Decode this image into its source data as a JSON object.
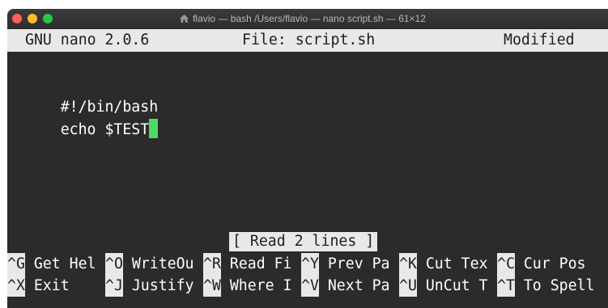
{
  "window": {
    "title": "flavio — bash /Users/flavio — nano script.sh — 61×12",
    "title_icon": "home-folder-icon"
  },
  "nano": {
    "version": "GNU nano 2.0.6",
    "file": "File: script.sh",
    "state": "Modified"
  },
  "buffer": {
    "lines": [
      "#!/bin/bash",
      "echo $TEST"
    ]
  },
  "status_message": "[ Read 2 lines ]",
  "shortcuts": {
    "row1": [
      {
        "key": "^G",
        "label": " Get Hel"
      },
      {
        "key": "^O",
        "label": " WriteOu"
      },
      {
        "key": "^R",
        "label": " Read Fi"
      },
      {
        "key": "^Y",
        "label": " Prev Pa"
      },
      {
        "key": "^K",
        "label": " Cut Tex"
      },
      {
        "key": "^C",
        "label": " Cur Pos"
      }
    ],
    "row2": [
      {
        "key": "^X",
        "label": " Exit"
      },
      {
        "key": "^J",
        "label": " Justify"
      },
      {
        "key": "^W",
        "label": " Where I"
      },
      {
        "key": "^V",
        "label": " Next Pa"
      },
      {
        "key": "^U",
        "label": " UnCut T"
      },
      {
        "key": "^T",
        "label": " To Spell"
      }
    ]
  },
  "colors": {
    "terminal_bg": "#2b2b2b",
    "inverse_bg": "#e8e8e8",
    "cursor": "#4cd964"
  }
}
